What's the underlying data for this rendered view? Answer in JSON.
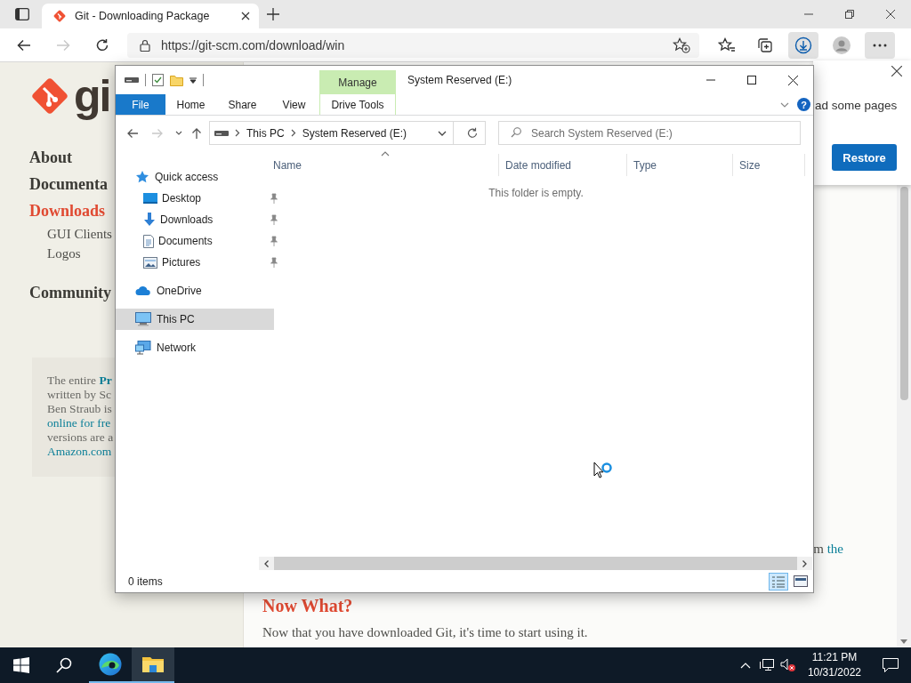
{
  "browser": {
    "tab": {
      "title": "Git - Downloading Package",
      "selected": true
    },
    "nav_buttons": [
      {
        "kind": "back",
        "disabled": false
      },
      {
        "kind": "forward",
        "disabled": true
      },
      {
        "kind": "refresh",
        "disabled": false
      }
    ],
    "address": "https://git-scm.com/download/win",
    "toolbar": [
      {
        "kind": "favorites",
        "active": false
      },
      {
        "kind": "collections",
        "active": false
      },
      {
        "kind": "downloads",
        "active": true
      },
      {
        "kind": "profile",
        "active": false
      },
      {
        "kind": "more",
        "active": true
      }
    ]
  },
  "page": {
    "logo_text": "gi",
    "nav": [
      {
        "label": "About",
        "selected": false
      },
      {
        "label": "Documenta",
        "selected": false
      },
      {
        "label": "Downloads",
        "selected": true,
        "children": [
          {
            "label": "GUI Clients"
          },
          {
            "label": "Logos"
          }
        ]
      },
      {
        "label": "Community",
        "selected": false
      }
    ],
    "book_lines": [
      [
        {
          "text": "The entire "
        },
        {
          "text": "Pr",
          "link": true,
          "bold": true
        }
      ],
      [
        {
          "text": "written by Sc"
        }
      ],
      [
        {
          "text": "Ben Straub is"
        }
      ],
      [
        {
          "text": "online for fre",
          "link": true
        }
      ],
      [
        {
          "text": "versions are a"
        }
      ],
      [
        {
          "text": "Amazon.com",
          "link": true
        }
      ]
    ],
    "main_line": [
      {
        "text": "m "
      },
      {
        "text": "the",
        "link": true
      }
    ],
    "heading": "Now What?",
    "paragraph": "Now that you have downloaded Git, it's time to start using it."
  },
  "download_popup": {
    "message": "ad some pages",
    "button": "Restore"
  },
  "explorer": {
    "title": "System Reserved (E:)",
    "contextual_group": "Manage",
    "ribbon_tabs": [
      {
        "label": "File",
        "kind": "file"
      },
      {
        "label": "Home",
        "kind": "tab"
      },
      {
        "label": "Share",
        "kind": "tab"
      },
      {
        "label": "View",
        "kind": "tab"
      },
      {
        "label": "Drive Tools",
        "kind": "contextual"
      }
    ],
    "help": "?",
    "path": [
      "This PC",
      "System Reserved (E:)"
    ],
    "search_placeholder": "Search System Reserved (E:)",
    "nav_pane": [
      {
        "label": "Quick access",
        "kind": "star",
        "selected": false,
        "children": [
          {
            "label": "Desktop",
            "kind": "desktop",
            "pinned": true,
            "selected": false
          },
          {
            "label": "Downloads",
            "kind": "download",
            "pinned": true,
            "selected": false
          },
          {
            "label": "Documents",
            "kind": "document",
            "pinned": true,
            "selected": false
          },
          {
            "label": "Pictures",
            "kind": "pictures",
            "pinned": true,
            "selected": false
          }
        ]
      },
      {
        "label": "OneDrive",
        "kind": "cloud",
        "selected": false
      },
      {
        "label": "This PC",
        "kind": "pc",
        "selected": true
      },
      {
        "label": "Network",
        "kind": "network",
        "selected": false
      }
    ],
    "columns": [
      {
        "label": "Name",
        "sorted": true
      },
      {
        "label": "Date modified",
        "sorted": false
      },
      {
        "label": "Type",
        "sorted": false
      },
      {
        "label": "Size",
        "sorted": false
      }
    ],
    "empty_message": "This folder is empty.",
    "status": "0 items",
    "view_modes": [
      {
        "kind": "details",
        "selected": true
      },
      {
        "kind": "large_icons",
        "selected": false
      }
    ]
  },
  "taskbar": {
    "apps": [
      {
        "kind": "edge",
        "running": true,
        "active": false
      },
      {
        "kind": "explorer",
        "running": true,
        "active": true
      }
    ],
    "volume_muted": true,
    "time": "11:21 PM",
    "date": "10/31/2022"
  }
}
